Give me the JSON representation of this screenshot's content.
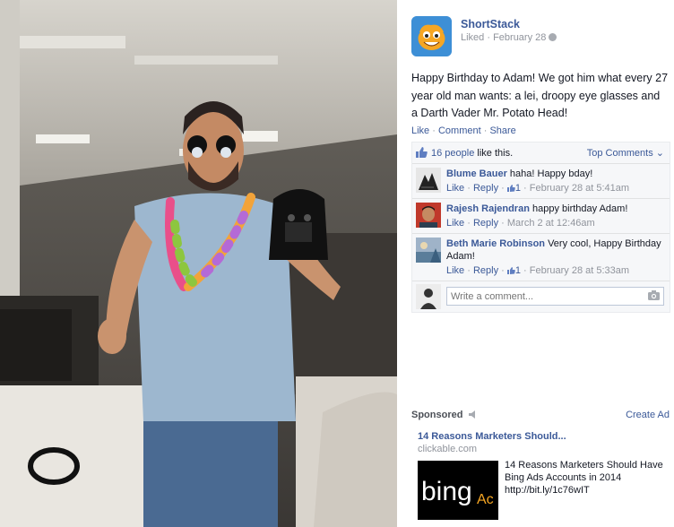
{
  "post": {
    "page_name": "ShortStack",
    "meta": "Liked · February 28",
    "text": "Happy Birthday to Adam! We got him what every 27 year old man wants: a lei, droopy eye glasses and a Darth Vader Mr. Potato Head!",
    "actions": {
      "like": "Like",
      "comment": "Comment",
      "share": "Share",
      "sep": " · "
    }
  },
  "ufi": {
    "likes_link": "16 people",
    "likes_suffix": " like this.",
    "top_comments": "Top Comments ⌄",
    "comments": [
      {
        "author": "Blume Bauer",
        "text": " haha! Happy bday!",
        "like": "Like",
        "reply": "Reply",
        "like_count": "1",
        "time": "February 28 at 5:41am"
      },
      {
        "author": "Rajesh Rajendran",
        "text": " happy birthday Adam!",
        "like": "Like",
        "reply": "Reply",
        "like_count": "",
        "time": "March 2 at 12:46am"
      },
      {
        "author": "Beth Marie Robinson",
        "text": " Very cool, Happy Birthday Adam!",
        "like": "Like",
        "reply": "Reply",
        "like_count": "1",
        "time": "February 28 at 5:33am"
      }
    ],
    "comment_placeholder": "Write a comment..."
  },
  "sponsored": {
    "label": "Sponsored",
    "create_ad": "Create Ad",
    "ad_title": "14 Reasons Marketers Should...",
    "ad_domain": "clickable.com",
    "ad_image_text": "bing",
    "ad_image_text2": "Ac",
    "ad_body": "14 Reasons Marketers Should Have Bing Ads Accounts in 2014 http://bit.ly/1c76wIT"
  },
  "icons": [
    "shortstack-logo-icon",
    "globe-icon",
    "like-thumb-icon",
    "camera-icon",
    "sponsored-icon"
  ],
  "colors": {
    "link": "#3b5998",
    "meta": "#90949c",
    "ufi_bg": "#f6f7f9"
  }
}
